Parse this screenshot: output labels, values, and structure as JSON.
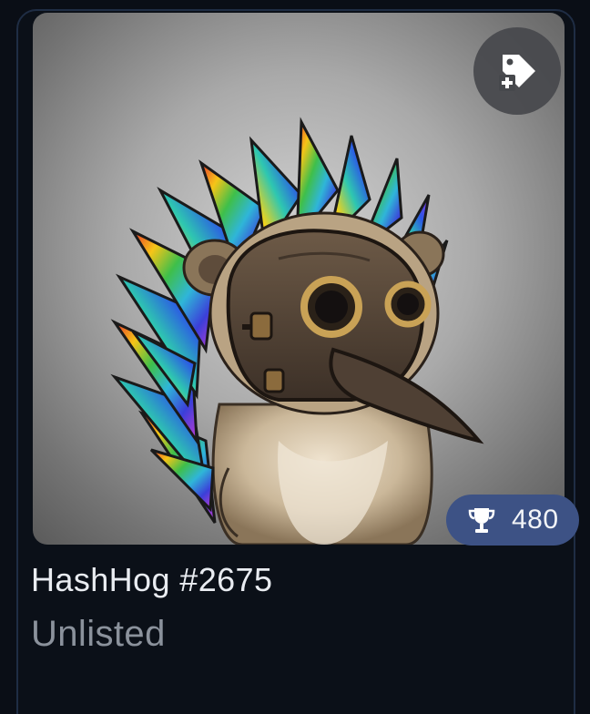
{
  "card": {
    "title": "HashHog #2675",
    "status": "Unlisted",
    "image": {
      "subject": "hedgehog character with rainbow quills wearing plague doctor mask"
    },
    "tag_action": {
      "icon": "tag-plus-icon"
    },
    "score": {
      "icon": "trophy-icon",
      "value": "480"
    }
  },
  "colors": {
    "page_background": "#0a0e16",
    "card_border": "#1f2d44",
    "score_badge": "#3d5285",
    "title_text": "#e9ecf1",
    "status_text": "#8b929c"
  }
}
